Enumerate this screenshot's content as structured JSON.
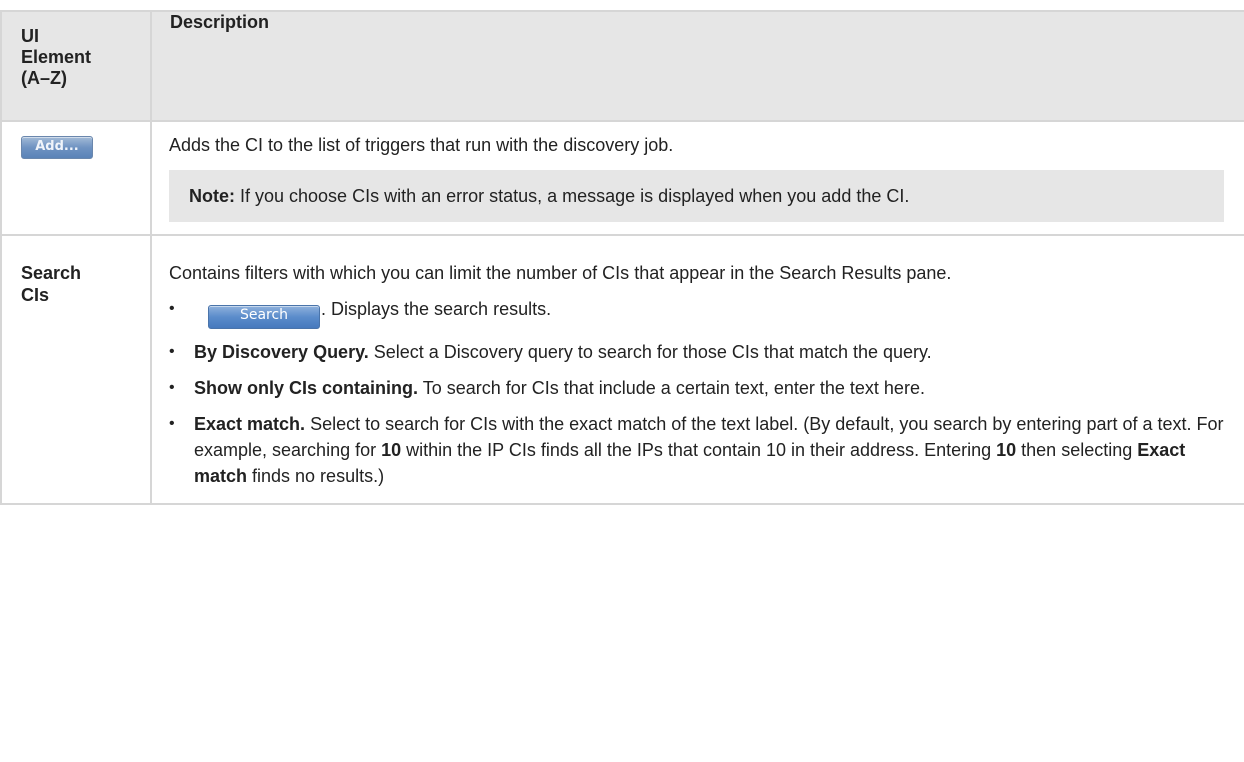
{
  "header": {
    "col1_lines": [
      "UI",
      "Element",
      "(A–Z)"
    ],
    "col2": "Description"
  },
  "rows": [
    {
      "element_button": "Add...",
      "description": "Adds the CI to the list of triggers that run with the discovery job.",
      "note_label": "Note:",
      "note_text": " If you choose CIs with an error status, a message is displayed when you add the CI."
    },
    {
      "element_name_lines": [
        "Search",
        "CIs"
      ],
      "description": "Contains filters with which you can limit the number of CIs that appear in the Search Results pane.",
      "bullets": [
        {
          "button": "Search",
          "text": ". Displays the search results."
        },
        {
          "bold": "By Discovery Query.",
          "text": " Select a Discovery query to search for those CIs that match the query."
        },
        {
          "bold": "Show only CIs containing.",
          "text": " To search for CIs that include a certain text, enter the text here."
        },
        {
          "bold": "Exact match.",
          "text_parts": [
            " Select to search for CIs with the exact match of the text label. (By default, you search by entering part of a text. For example, searching for ",
            "10",
            " within the IP CIs finds all the IPs that contain 10 in their address. Entering ",
            "10",
            " then selecting ",
            "Exact match",
            " finds no results.)"
          ]
        }
      ]
    }
  ]
}
